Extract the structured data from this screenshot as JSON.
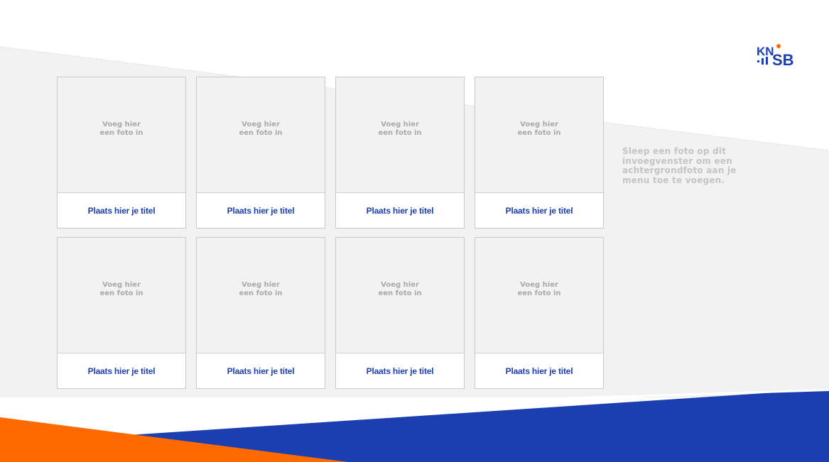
{
  "slide": {
    "logo_text": "KNSB",
    "background_hint": "Sleep een foto op dit invoegvenster om een achtergrondfoto aan je menu toe te voegen."
  },
  "tiles": [
    {
      "photo_placeholder": "Voeg hier\neen foto in",
      "title": "Plaats hier je titel"
    },
    {
      "photo_placeholder": "Voeg hier\neen foto in",
      "title": "Plaats hier je titel"
    },
    {
      "photo_placeholder": "Voeg hier\neen foto in",
      "title": "Plaats hier je titel"
    },
    {
      "photo_placeholder": "Voeg hier\neen foto in",
      "title": "Plaats hier je titel"
    },
    {
      "photo_placeholder": "Voeg hier\neen foto in",
      "title": "Plaats hier je titel"
    },
    {
      "photo_placeholder": "Voeg hier\neen foto in",
      "title": "Plaats hier je titel"
    },
    {
      "photo_placeholder": "Voeg hier\neen foto in",
      "title": "Plaats hier je titel"
    },
    {
      "photo_placeholder": "Voeg hier\neen foto in",
      "title": "Plaats hier je titel"
    }
  ],
  "colors": {
    "brand_blue": "#1b3fb0",
    "brand_orange": "#ff6a00",
    "panel_gray": "#f2f2f2",
    "placeholder_text": "#a9a9a9"
  }
}
